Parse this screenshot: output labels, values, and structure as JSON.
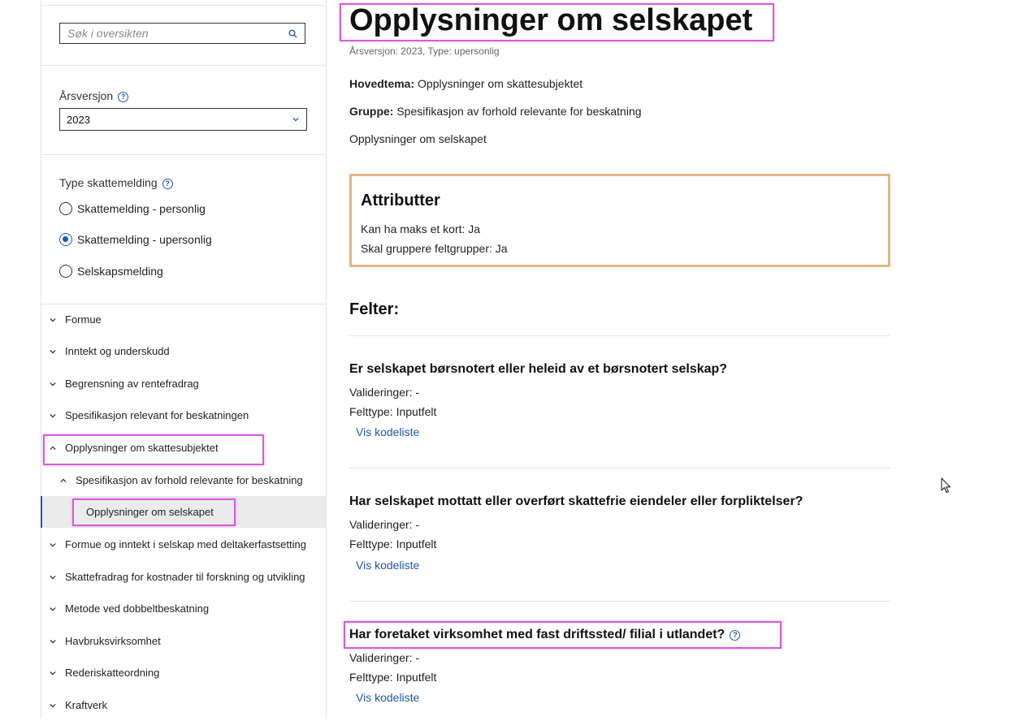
{
  "sidebar": {
    "search": {
      "placeholder": "Søk i oversikten"
    },
    "year": {
      "label": "Årsversjon",
      "selected": "2023"
    },
    "type": {
      "label": "Type skattemelding",
      "options": [
        {
          "label": "Skattemelding - personlig",
          "checked": false
        },
        {
          "label": "Skattemelding - upersonlig",
          "checked": true
        },
        {
          "label": "Selskapsmelding",
          "checked": false
        }
      ]
    },
    "nav": [
      {
        "label": "Formue"
      },
      {
        "label": "Inntekt og underskudd"
      },
      {
        "label": "Begrensning av rentefradrag"
      },
      {
        "label": "Spesifikasjon relevant for beskatningen"
      },
      {
        "label": "Opplysninger om skattesubjektet"
      },
      {
        "label": "Spesifikasjon av forhold relevante for beskatning"
      },
      {
        "label": "Opplysninger om selskapet"
      },
      {
        "label": "Formue og inntekt i selskap med deltakerfastsetting"
      },
      {
        "label": "Skattefradrag for kostnader til forskning og utvikling"
      },
      {
        "label": "Metode ved dobbeltbeskatning"
      },
      {
        "label": "Havbruksvirksomhet"
      },
      {
        "label": "Rederiskatteordning"
      },
      {
        "label": "Kraftverk"
      }
    ]
  },
  "main": {
    "title": "Opplysninger om selskapet",
    "meta": "Årsversjon: 2023, Type: upersonlig",
    "hovedtema_label": "Hovedtema:",
    "hovedtema": "Opplysninger om skattesubjektet",
    "gruppe_label": "Gruppe:",
    "gruppe": "Spesifikasjon av forhold relevante for beskatning",
    "description": "Opplysninger om selskapet",
    "attributes": {
      "heading": "Attributter",
      "rows": [
        "Kan ha maks et kort: Ja",
        "Skal gruppere feltgrupper: Ja"
      ]
    },
    "fields_heading": "Felter:",
    "fields": [
      {
        "title": "Er selskapet børsnotert eller heleid av et børsnotert selskap?",
        "validation": "Valideringer: -",
        "type": "Felttype: Inputfelt",
        "link": "Vis kodeliste"
      },
      {
        "title": "Har selskapet mottatt eller overført skattefrie eiendeler eller forpliktelser?",
        "validation": "Valideringer: -",
        "type": "Felttype: Inputfelt",
        "link": "Vis kodeliste"
      },
      {
        "title": "Har foretaket virksomhet med fast driftssted/ filial i utlandet?",
        "validation": "Valideringer: -",
        "type": "Felttype: Inputfelt",
        "link": "Vis kodeliste"
      }
    ]
  },
  "colors": {
    "accent": "#1f5aa6",
    "highlight": "#d85bd8",
    "attr_border": "#e0b884"
  }
}
